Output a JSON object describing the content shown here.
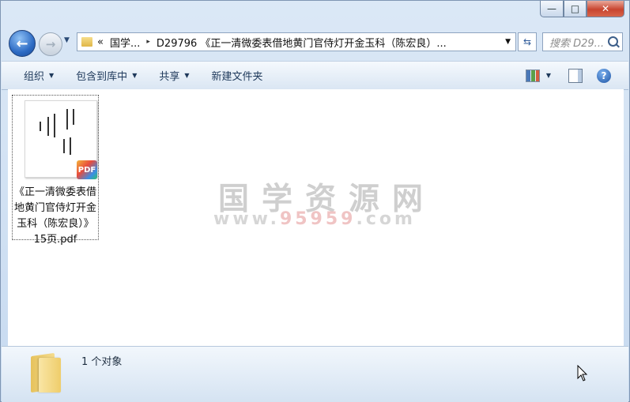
{
  "window": {
    "controls": {
      "minimize": "—",
      "maximize": "□",
      "close": "✕"
    }
  },
  "nav": {
    "back_icon": "back-arrow-icon",
    "forward_icon": "forward-arrow-icon",
    "address": {
      "chevron": "«",
      "segments": [
        "国学...",
        "D29796 《正一清微委表借地黄门官侍灯开金玉科（陈宏良）..."
      ],
      "separator": "▸"
    },
    "search_placeholder": "搜索 D29..."
  },
  "toolbar": {
    "organize": "组织",
    "include_library": "包含到库中",
    "share": "共享",
    "new_folder": "新建文件夹"
  },
  "file": {
    "name": "《正一清微委表借地黄门官侍灯开金玉科（陈宏良）》15页.pdf",
    "badge": "PDF"
  },
  "watermark": {
    "line1": "国学资源网",
    "line2_prefix": "www.",
    "line2_number": "95959",
    "line2_suffix": ".com"
  },
  "status": {
    "count_text": "1 个对象"
  }
}
